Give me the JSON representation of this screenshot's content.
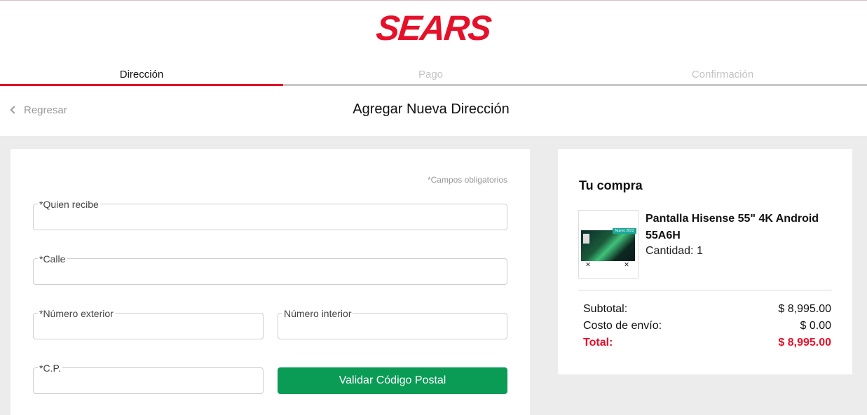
{
  "brand": {
    "logo_text": "SEARS",
    "accent_color": "#e5112a",
    "success_color": "#0a9b55"
  },
  "steps": [
    {
      "label": "Dirección",
      "state": "active"
    },
    {
      "label": "Pago",
      "state": "inactive"
    },
    {
      "label": "Confirmación",
      "state": "inactive"
    }
  ],
  "nav": {
    "back_label": "Regresar",
    "page_title": "Agregar Nueva Dirección"
  },
  "form": {
    "required_note": "*Campos obligatorios",
    "fields": {
      "quien_recibe": {
        "label": "*Quien recibe",
        "value": ""
      },
      "calle": {
        "label": "*Calle",
        "value": ""
      },
      "numero_exterior": {
        "label": "*Número exterior",
        "value": ""
      },
      "numero_interior": {
        "label": "Número interior",
        "value": ""
      },
      "cp": {
        "label": "*C.P.",
        "value": ""
      }
    },
    "validate_button": "Validar Código Postal"
  },
  "summary": {
    "title": "Tu compra",
    "product": {
      "name": "Pantalla Hisense 55\" 4K Android 55A6H",
      "quantity_label": "Cantidad: 1",
      "image_ribbon": "Nuevo 2022"
    },
    "subtotal_label": "Subtotal:",
    "subtotal_value": "$ 8,995.00",
    "shipping_label": "Costo de envío:",
    "shipping_value": "$ 0.00",
    "total_label": "Total:",
    "total_value": "$ 8,995.00"
  }
}
